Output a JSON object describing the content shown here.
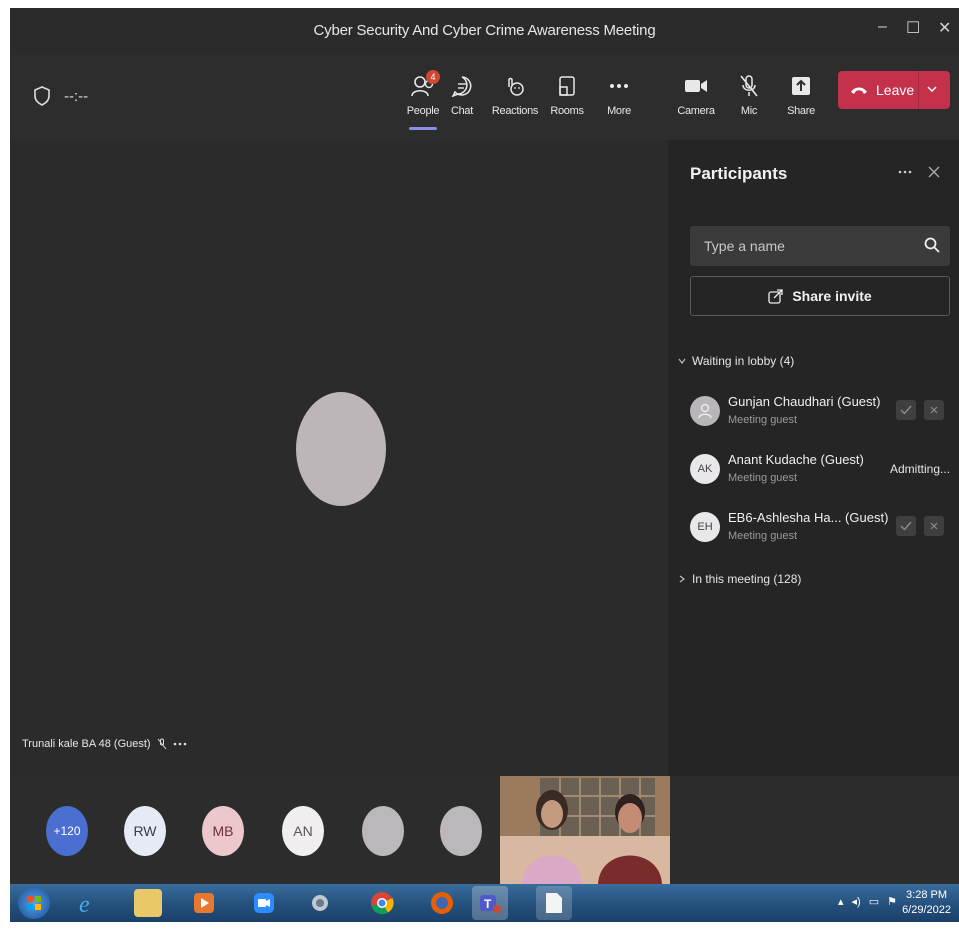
{
  "window": {
    "title": "Cyber Security And Cyber Crime Awareness Meeting",
    "controls": {
      "minimize": "–",
      "maximize": "☐",
      "close": "✕"
    }
  },
  "toolbar": {
    "timer": "--:--",
    "items": [
      {
        "label": "People",
        "icon": "people-icon",
        "badge": "4"
      },
      {
        "label": "Chat",
        "icon": "chat-icon"
      },
      {
        "label": "Reactions",
        "icon": "reactions-icon"
      },
      {
        "label": "Rooms",
        "icon": "rooms-icon"
      },
      {
        "label": "More",
        "icon": "more-icon"
      },
      {
        "label": "Camera",
        "icon": "camera-icon"
      },
      {
        "label": "Mic",
        "icon": "mic-off-icon"
      },
      {
        "label": "Share",
        "icon": "share-icon"
      }
    ],
    "leave_label": "Leave",
    "accent": "#c4314b"
  },
  "stage": {
    "speaker_name": "Trunali kale BA 48 (Guest)"
  },
  "participants_panel": {
    "title": "Participants",
    "search_placeholder": "Type a name",
    "share_invite": "Share invite",
    "lobby_header": "Waiting in lobby (4)",
    "lobby": [
      {
        "initials": "",
        "name": "Gunjan Chaudhari (Guest)",
        "role": "Meeting guest",
        "status": ""
      },
      {
        "initials": "AK",
        "name": "Anant Kudache (Guest)",
        "role": "Meeting guest",
        "status": "Admitting..."
      },
      {
        "initials": "EH",
        "name": "EB6-Ashlesha Ha... (Guest)",
        "role": "Meeting guest",
        "status": ""
      }
    ],
    "meeting_header": "In this meeting (128)"
  },
  "strip": {
    "overflow": "+120",
    "avatars": [
      "RW",
      "MB",
      "AN",
      "",
      ""
    ]
  },
  "taskbar": {
    "time": "3:28 PM",
    "date": "6/29/2022"
  }
}
